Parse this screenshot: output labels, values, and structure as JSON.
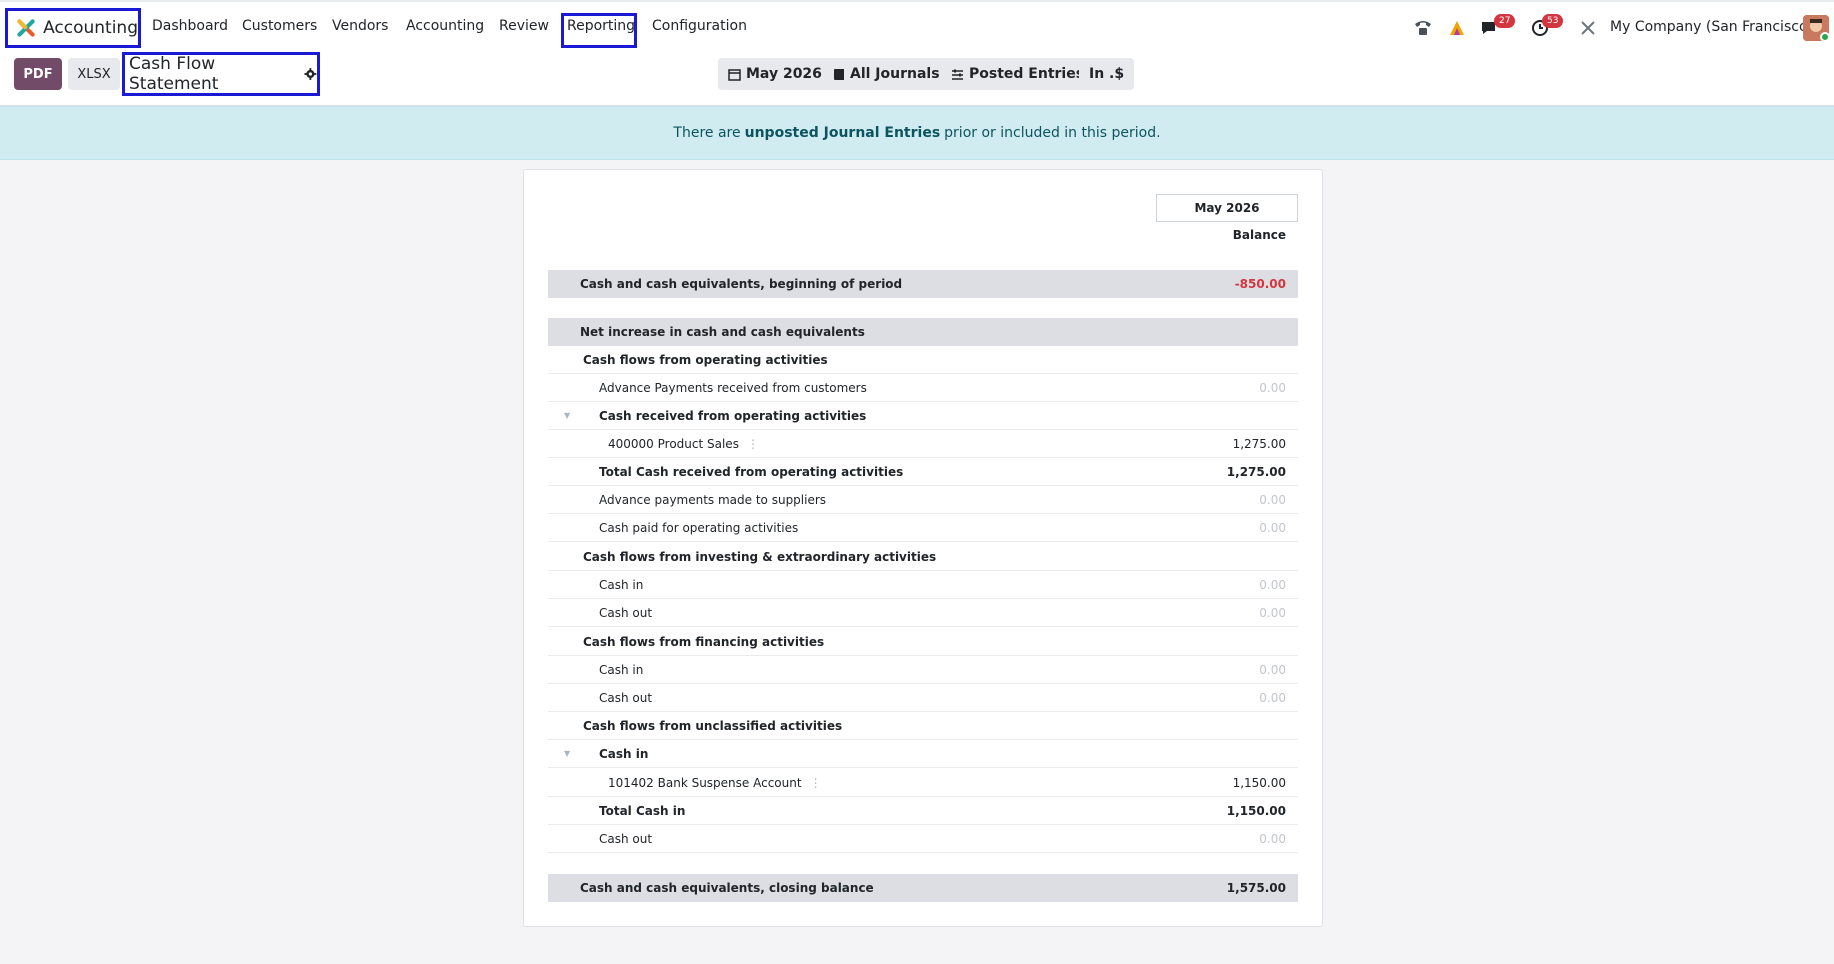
{
  "app": {
    "name": "Accounting"
  },
  "nav": {
    "items": [
      "Dashboard",
      "Customers",
      "Vendors",
      "Accounting",
      "Review",
      "Reporting",
      "Configuration"
    ]
  },
  "systray": {
    "messages_count": "27",
    "activities_count": "53",
    "company": "My Company (San Francisco)"
  },
  "control": {
    "pdf_label": "PDF",
    "xlsx_label": "XLSX",
    "report_title": "Cash Flow Statement",
    "filters": [
      "May 2026",
      "All Journals",
      "Posted Entries",
      "In .$"
    ]
  },
  "alert": {
    "prefix": "There are",
    "strong": "unposted Journal Entries",
    "suffix": "prior or included in this period."
  },
  "report": {
    "period": "May 2026",
    "column": "Balance",
    "rows": [
      {
        "label": "Cash and cash equivalents, beginning of period",
        "amount": "-850.00"
      },
      {
        "label": "Net increase in cash and cash equivalents",
        "amount": ""
      },
      {
        "label": "Cash flows from operating activities",
        "amount": ""
      },
      {
        "label": "Advance Payments received from customers",
        "amount": "0.00"
      },
      {
        "label": "Cash received from operating activities",
        "amount": ""
      },
      {
        "label": "400000 Product Sales",
        "amount": "1,275.00"
      },
      {
        "label": "Total Cash received from operating activities",
        "amount": "1,275.00"
      },
      {
        "label": "Advance payments made to suppliers",
        "amount": "0.00"
      },
      {
        "label": "Cash paid for operating activities",
        "amount": "0.00"
      },
      {
        "label": "Cash flows from investing & extraordinary activities",
        "amount": ""
      },
      {
        "label": "Cash in",
        "amount": "0.00"
      },
      {
        "label": "Cash out",
        "amount": "0.00"
      },
      {
        "label": "Cash flows from financing activities",
        "amount": ""
      },
      {
        "label": "Cash in",
        "amount": "0.00"
      },
      {
        "label": "Cash out",
        "amount": "0.00"
      },
      {
        "label": "Cash flows from unclassified activities",
        "amount": ""
      },
      {
        "label": "Cash in",
        "amount": ""
      },
      {
        "label": "101402 Bank Suspense Account",
        "amount": "1,150.00"
      },
      {
        "label": "Total Cash in",
        "amount": "1,150.00"
      },
      {
        "label": "Cash out",
        "amount": "0.00"
      },
      {
        "label": "Cash and cash equivalents, closing balance",
        "amount": "1,575.00"
      }
    ]
  }
}
